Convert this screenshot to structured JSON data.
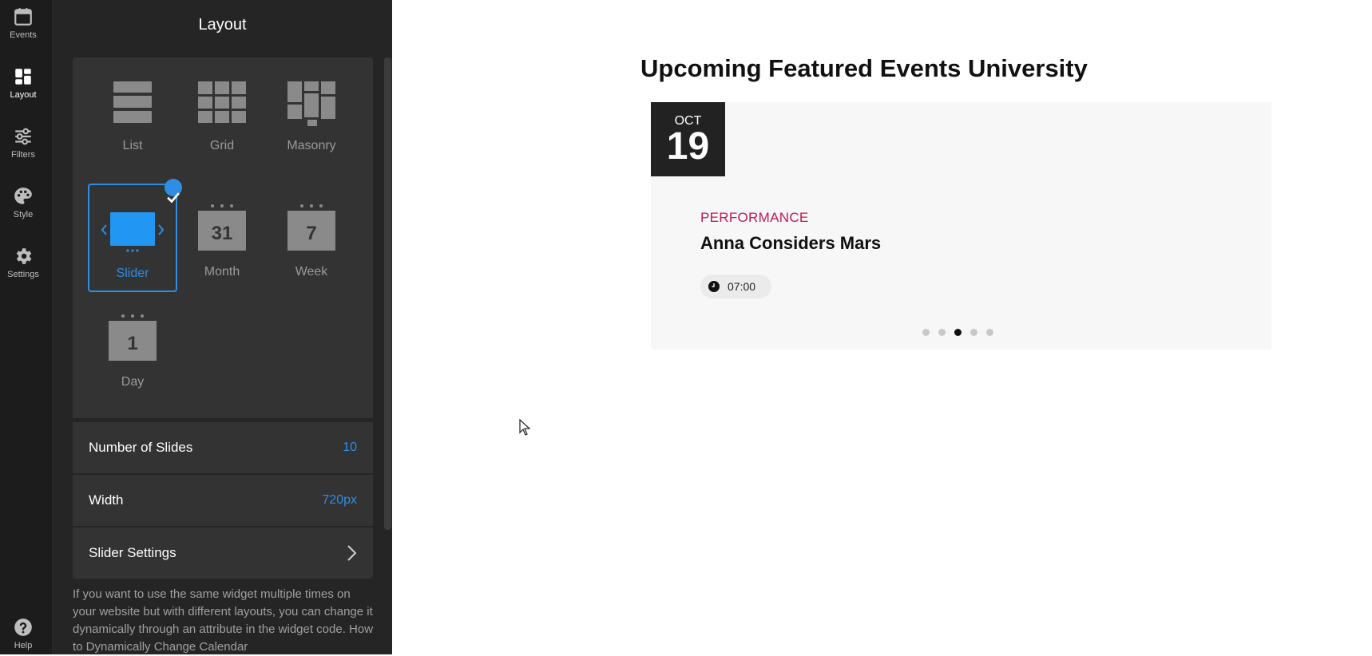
{
  "sidebar": {
    "items": [
      {
        "label": "Events",
        "icon": "calendar-icon"
      },
      {
        "label": "Layout",
        "icon": "layout-icon"
      },
      {
        "label": "Filters",
        "icon": "sliders-icon"
      },
      {
        "label": "Style",
        "icon": "palette-icon"
      },
      {
        "label": "Settings",
        "icon": "gear-icon"
      }
    ],
    "help": {
      "label": "Help",
      "icon": "help-icon"
    }
  },
  "panel": {
    "title": "Layout",
    "layouts": [
      {
        "label": "List",
        "icon": "list-layout-icon"
      },
      {
        "label": "Grid",
        "icon": "grid-layout-icon"
      },
      {
        "label": "Masonry",
        "icon": "masonry-layout-icon"
      },
      {
        "label": "Slider",
        "icon": "slider-layout-icon",
        "selected": true
      },
      {
        "label": "Month",
        "icon": "month-layout-icon",
        "glyph": "31"
      },
      {
        "label": "Week",
        "icon": "week-layout-icon",
        "glyph": "7"
      },
      {
        "label": "Day",
        "icon": "day-layout-icon",
        "glyph": "1"
      }
    ],
    "number_of_slides": {
      "label": "Number of Slides",
      "value": "10"
    },
    "width": {
      "label": "Width",
      "value": "720px"
    },
    "slider_settings": {
      "label": "Slider Settings"
    },
    "help_text": "If you want to use the same widget multiple times on your website but with different layouts, you can change it dynamically through an attribute in the widget code. How to Dynamically Change Calendar"
  },
  "preview": {
    "title": "Upcoming Featured Events University",
    "event": {
      "month": "OCT",
      "day": "19",
      "category": "PERFORMANCE",
      "title": "Anna Considers Mars",
      "time": "07:00"
    },
    "pagination": {
      "count": 5,
      "active_index": 2
    }
  },
  "colors": {
    "accent": "#2f8de4",
    "category": "#c2185b",
    "rail_bg": "#1c1c1c",
    "panel_bg": "#252525"
  }
}
